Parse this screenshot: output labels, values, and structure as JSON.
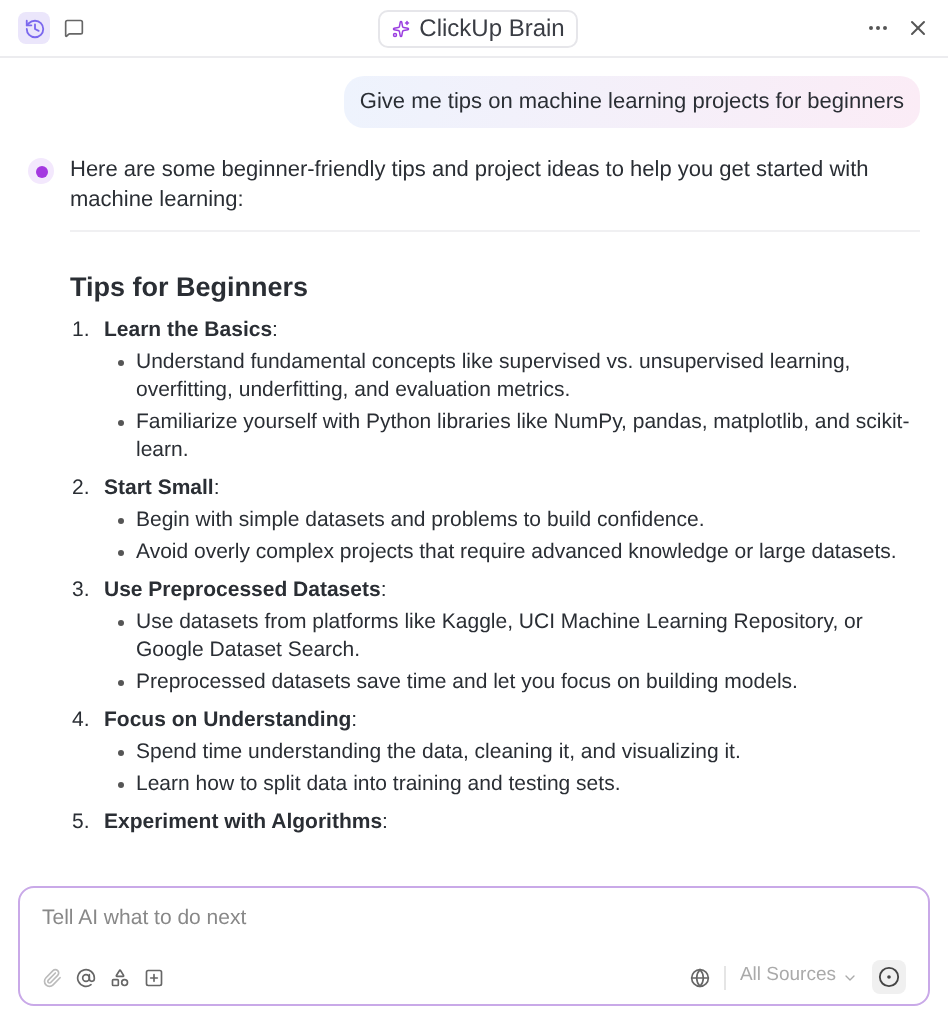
{
  "header": {
    "history_selected": true,
    "title": "ClickUp Brain"
  },
  "user_message": "Give me tips on machine learning projects for beginners",
  "reply": {
    "intro": "Here are some beginner-friendly tips and project ideas to help you get started with machine learning:",
    "heading": "Tips for Beginners",
    "items": [
      {
        "number": "1.",
        "title": "**Learn the Basics**:",
        "bullets": [
          "Understand fundamental concepts like supervised vs. unsupervised learning, overfitting, underfitting, and evaluation metrics.",
          "Familiarize yourself with Python libraries like NumPy, pandas, matplotlib, and scikit-learn."
        ]
      },
      {
        "number": "2.",
        "title": "**Start Small**:",
        "bullets": [
          "Begin with simple datasets and problems to build confidence.",
          "Avoid overly complex projects that require advanced knowledge or large datasets."
        ]
      },
      {
        "number": "3.",
        "title": "**Use Preprocessed Datasets**:",
        "bullets": [
          "Use datasets from platforms like Kaggle, UCI Machine Learning Repository, or Google Dataset Search.",
          "Preprocessed datasets save time and let you focus on building models."
        ]
      },
      {
        "number": "4.",
        "title": "**Focus on Understanding**:",
        "bullets": [
          "Spend time understanding the data, cleaning it, and visualizing it.",
          "Learn how to split data into training and testing sets."
        ]
      },
      {
        "number": "5.",
        "title": "**Experiment with Algorithms**:"
      }
    ]
  },
  "composer": {
    "placeholder": "Tell AI what to do next",
    "sources": "All Sources"
  }
}
